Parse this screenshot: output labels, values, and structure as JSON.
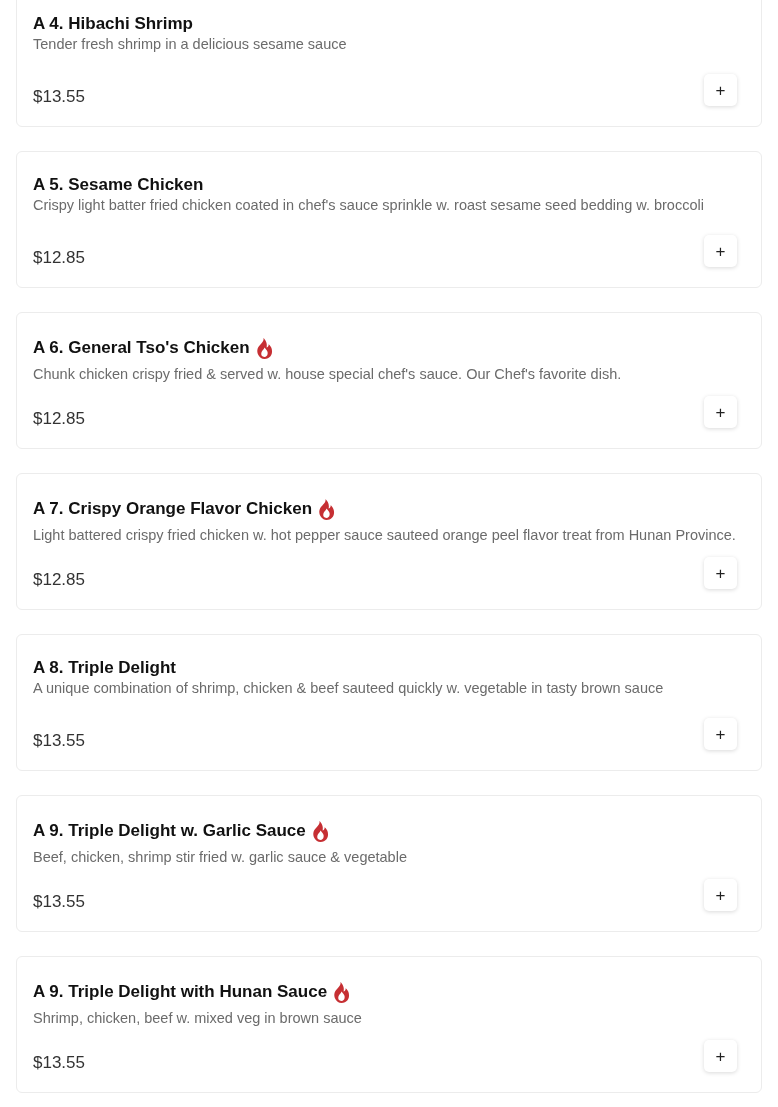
{
  "items": [
    {
      "title": "A 4. Hibachi Shrimp",
      "spicy": false,
      "description": "Tender fresh shrimp in a delicious sesame sauce",
      "price": "$13.55",
      "button": "+"
    },
    {
      "title": "A 5. Sesame Chicken",
      "spicy": false,
      "description": "Crispy light batter fried chicken coated in chef's sauce sprinkle w. roast sesame seed bedding w. broccoli",
      "price": "$12.85",
      "button": "+"
    },
    {
      "title": "A 6. General Tso's Chicken",
      "spicy": true,
      "description": "Chunk chicken crispy fried & served w. house special chef's sauce. Our Chef's favorite dish.",
      "price": "$12.85",
      "button": "+"
    },
    {
      "title": "A 7. Crispy Orange Flavor Chicken",
      "spicy": true,
      "description": "Light battered crispy fried chicken w. hot pepper sauce sauteed orange peel flavor treat from Hunan Province.",
      "price": "$12.85",
      "button": "+"
    },
    {
      "title": "A 8. Triple Delight",
      "spicy": false,
      "description": "A unique combination of shrimp, chicken & beef sauteed quickly w. vegetable in tasty brown sauce",
      "price": "$13.55",
      "button": "+"
    },
    {
      "title": "A 9. Triple Delight w. Garlic Sauce",
      "spicy": true,
      "description": "Beef, chicken, shrimp stir fried w. garlic sauce & vegetable",
      "price": "$13.55",
      "button": "+"
    },
    {
      "title": "A 9. Triple Delight with Hunan Sauce",
      "spicy": true,
      "description": "Shrimp, chicken, beef w. mixed veg in brown sauce",
      "price": "$13.55",
      "button": "+"
    }
  ]
}
